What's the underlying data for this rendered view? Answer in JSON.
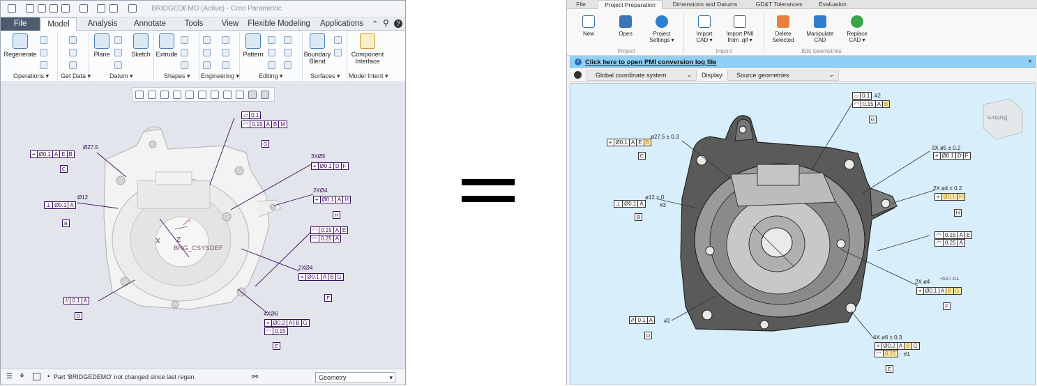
{
  "creo": {
    "window_title": "BRIDGEDEMO (Active) - Creo Parametric",
    "tabs": [
      "File",
      "Model",
      "Analysis",
      "Annotate",
      "Tools",
      "View",
      "Flexible Modeling",
      "Applications"
    ],
    "buttons": {
      "regenerate": "Regenerate",
      "plane": "Plane",
      "sketch": "Sketch",
      "extrude": "Extrude",
      "pattern": "Pattern",
      "boundary_blend": "Boundary\nBlend",
      "component_interface": "Component\nInterface"
    },
    "groups": [
      "Operations ▾",
      "Get Data ▾",
      "Datum ▾",
      "Shapes ▾",
      "Engineering ▾",
      "Editing ▾",
      "Surfaces ▾",
      "Model Intent ▾"
    ],
    "status_msg": "Part 'BRIDGEDEMO' not changed since last regen.",
    "filter_value": "Geometry",
    "csys_label": "BRG_CSYSDEF",
    "annotations": {
      "flat": "0.1",
      "prof1": "0.15",
      "prof1_refs": [
        "A",
        "B",
        "M"
      ],
      "datum_g": "G",
      "dia275": "Ø27.5",
      "pos275": "Ø0.1",
      "pos275_refs": [
        "A",
        "E",
        "M",
        "B",
        "M"
      ],
      "datum_c": "C",
      "dia5": "3XØ5",
      "pos5": "Ø0.1",
      "pos5_refs": [
        "D",
        "F",
        "M"
      ],
      "dia4a": "2XØ4",
      "pos4a": "Ø0.1",
      "pos4a_refs": [
        "A",
        "H",
        "M"
      ],
      "datum_h": "H",
      "dia12": "Ø12",
      "perp12": "Ø0.1",
      "perp12_refs": [
        "A"
      ],
      "datum_b": "B",
      "prof2": "0.15",
      "prof2_refs": [
        "A",
        "E",
        "M"
      ],
      "prof3": "0.25",
      "prof3_refs": [
        "A"
      ],
      "dia4b": "2XØ4",
      "pos4b": "Ø0.1",
      "pos4b_refs": [
        "A",
        "B",
        "M",
        "G",
        "M"
      ],
      "datum_f": "F",
      "par": "0.1",
      "par_refs": [
        "A"
      ],
      "datum_d": "D",
      "dia6": "4XØ6",
      "pos6": "Ø0.2",
      "pos6_refs": [
        "A",
        "B",
        "M",
        "G"
      ],
      "prof6": "0.15",
      "datum_e": "E"
    }
  },
  "pmi": {
    "tabs": [
      "File",
      "Project Preparation",
      "Dimensions and Datums",
      "GD&T Tolerances",
      "Evaluation"
    ],
    "buttons": [
      "New",
      "Open",
      "Project\nSettings ▾",
      "Import\nCAD ▾",
      "Import PMI\nfrom .qif ▾",
      "Delete\nSelected",
      "Manipulate\nCAD",
      "Replace\nCAD ▾"
    ],
    "groups": [
      "Project",
      "Import",
      "Edit Geometries"
    ],
    "info_link": "Click here to open PMI conversion log file",
    "close": "×",
    "coord_system": "Global coordinate system",
    "display_label": "Display:",
    "display_value": "Source geometries",
    "viewcube_label": "Bottom",
    "annotations": {
      "flat": "0.1",
      "flat_tag": "#2",
      "prof": "0.15",
      "prof_refs": [
        "A",
        "B",
        "M"
      ],
      "datum_g": "G",
      "dia275": "ø27.5 ± 0.3",
      "pos275": "Ø0.1",
      "pos275_refs": [
        "A",
        "E",
        "M",
        "B",
        "M"
      ],
      "datum_c": "C",
      "dia5": "3X ø5 ± 0.2",
      "pos5": "Ø0.1",
      "pos5_refs": [
        "D",
        "F",
        "M"
      ],
      "dia4a": "2X ø4 ± 0.2",
      "pos4a": "Ø0.1",
      "pos4a_refs": [
        "H",
        "M"
      ],
      "datum_h": "H",
      "dia12": "ø12 ± 0",
      "perp12": "Ø0.1",
      "perp12_refs": [
        "A"
      ],
      "perp12_tag": "#3",
      "datum_b": "B",
      "prof2": "0.15",
      "prof2_refs": [
        "A",
        "E",
        "M"
      ],
      "prof3": "0.25",
      "prof3_refs": [
        "A"
      ],
      "dia4b": "2X ø4",
      "dia4b_tol": "+0.2 / -0.1",
      "pos4b": "Ø0.1",
      "pos4b_refs": [
        "A",
        "B",
        "M",
        "G",
        "M"
      ],
      "datum_f": "F",
      "par": "0.1",
      "par_refs": [
        "A"
      ],
      "par_tag": "#2",
      "datum_d": "D",
      "dia6": "4X ø6 ± 0.3",
      "pos6": "Ø0.2",
      "pos6_refs": [
        "A",
        "B",
        "M",
        "G"
      ],
      "prof6": "0.15",
      "prof6_tag": "#1",
      "datum_e": "E"
    }
  },
  "colors": {
    "creo_file_tab": "#4d5b6c",
    "pmi_viewer_bg": "#d8eefb",
    "info_bar": "#8fd0f6",
    "purple_annotation": "#3a0a5a",
    "yellow_highlight": "#fde9b0"
  }
}
